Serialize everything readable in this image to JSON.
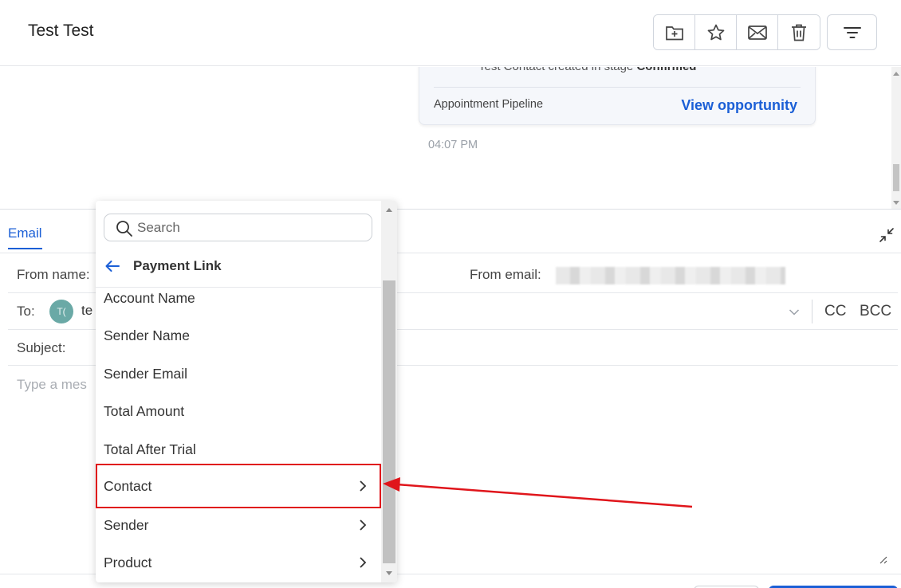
{
  "header": {
    "title": "Test Test",
    "actions": [
      {
        "name": "move-to-folder-button",
        "icon": "folder-plus-icon"
      },
      {
        "name": "star-button",
        "icon": "star-icon"
      },
      {
        "name": "mark-email-button",
        "icon": "mail-icon"
      },
      {
        "name": "delete-button",
        "icon": "trash-icon"
      }
    ],
    "filter_icon": "filter-lines-icon"
  },
  "conversation": {
    "card": {
      "activity_prefix": "Test Contact created in stage ",
      "activity_stage": "Confirmed",
      "pipeline": "Appointment Pipeline",
      "link": "View opportunity"
    },
    "timestamp": "04:07 PM"
  },
  "composer": {
    "tab": "Email",
    "from_name_label": "From name:",
    "from_email_label": "From email:",
    "to_label": "To:",
    "to_avatar": "T(",
    "to_value": "te",
    "cc_label": "CC",
    "bcc_label": "BCC",
    "subject_label": "Subject:",
    "message_placeholder": "Type a mes"
  },
  "dropdown": {
    "search_placeholder": "Search",
    "back_label": "Payment Link",
    "items": [
      {
        "label": "Account Name",
        "has_submenu": false
      },
      {
        "label": "Sender Name",
        "has_submenu": false
      },
      {
        "label": "Sender Email",
        "has_submenu": false
      },
      {
        "label": "Total Amount",
        "has_submenu": false
      },
      {
        "label": "Total After Trial",
        "has_submenu": false
      },
      {
        "label": "Contact",
        "has_submenu": true,
        "highlighted": true
      },
      {
        "label": "Sender",
        "has_submenu": true
      },
      {
        "label": "Product",
        "has_submenu": true
      }
    ]
  },
  "colors": {
    "accent": "#1b5fd6",
    "annotation": "#e0151b",
    "avatar": "#6aa9a6"
  }
}
